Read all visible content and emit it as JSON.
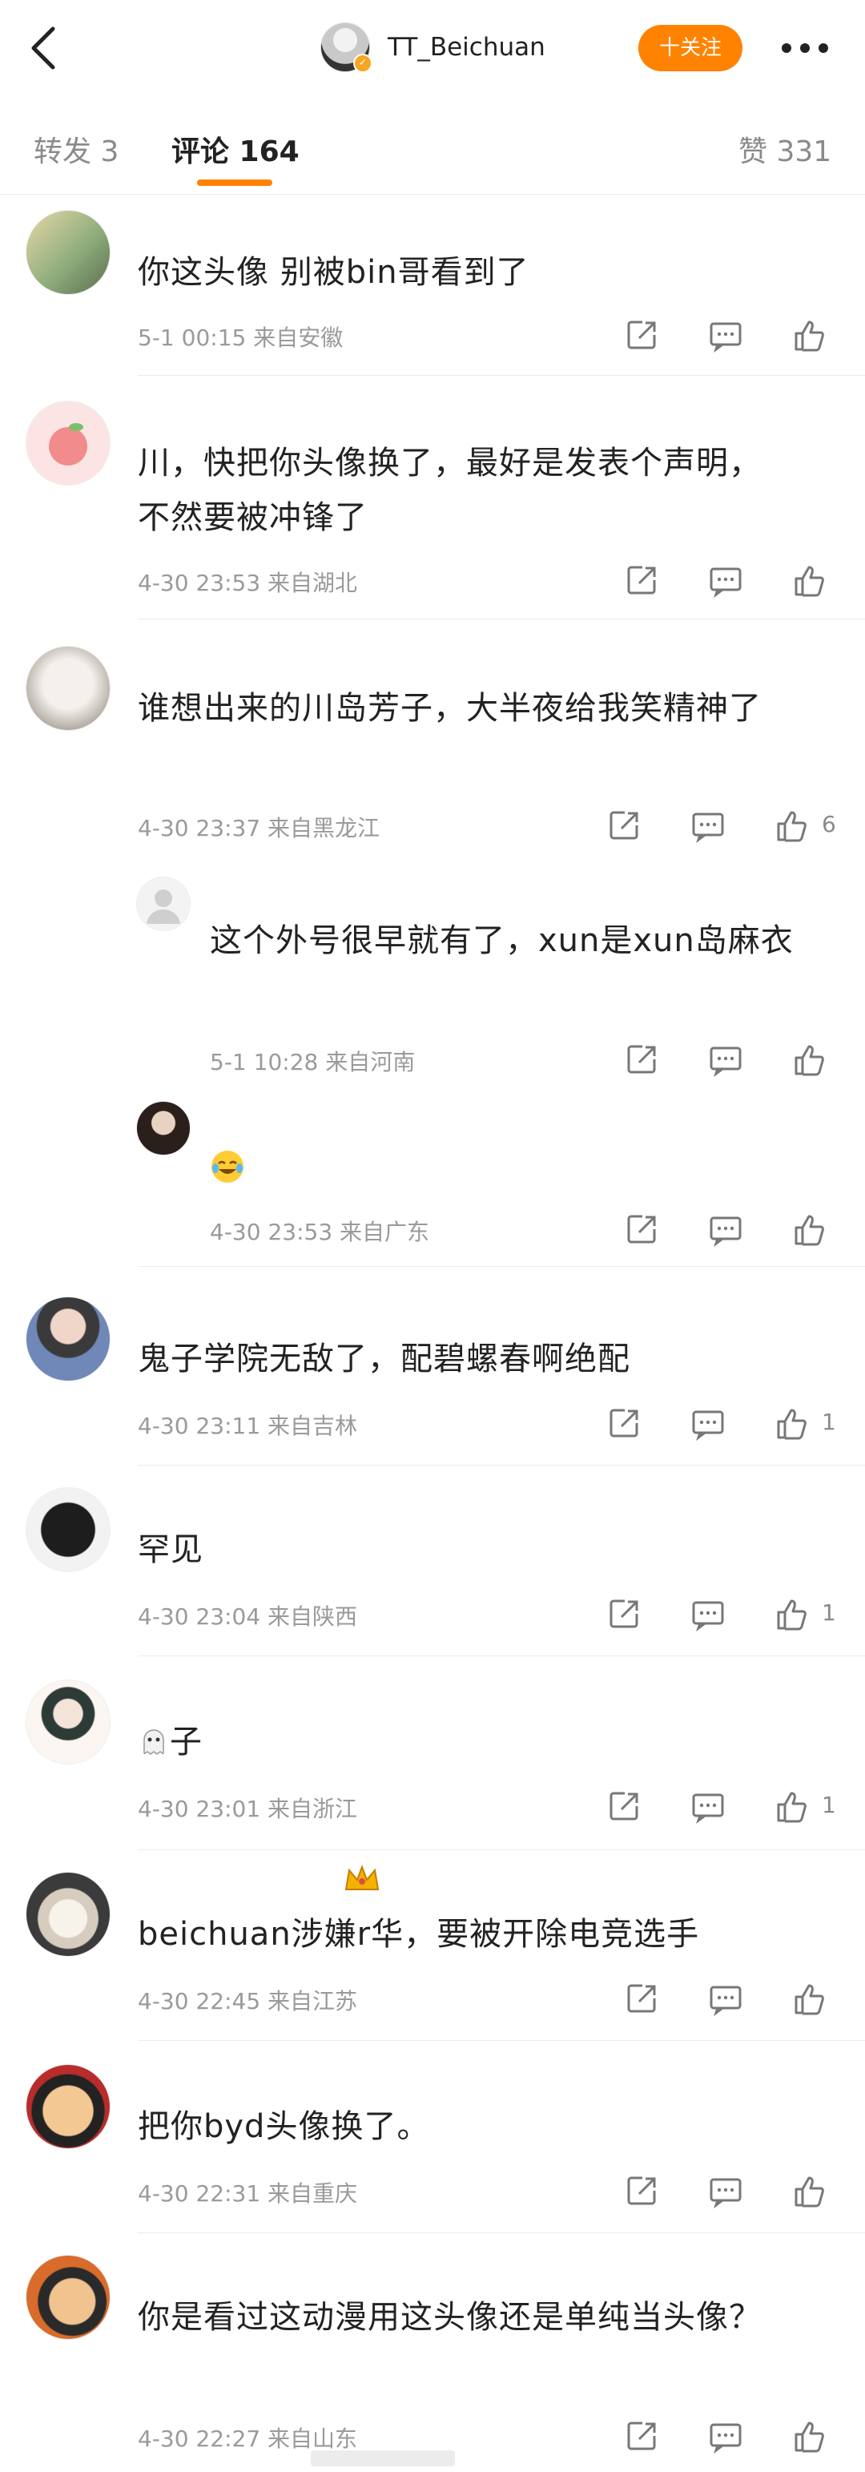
{
  "header": {
    "title": "TT_Beichuan",
    "follow_label": "十关注"
  },
  "tabs": [
    {
      "label": "转发 3"
    },
    {
      "label": "评论 164"
    },
    {
      "label": "赞 331"
    }
  ],
  "comments": [
    {
      "text": "你这头像 别被bin哥看到了",
      "time": "5-1 00:15",
      "location": "来自安徽",
      "likes": ""
    },
    {
      "text": "川，快把你头像换了，最好是发表个声明，不然要被冲锋了",
      "time": "4-30 23:53",
      "location": "来自湖北",
      "likes": ""
    },
    {
      "text": "谁想出来的川岛芳子，大半夜给我笑精神了",
      "time": "4-30 23:37",
      "location": "来自黑龙江",
      "likes": "6"
    },
    {
      "text": "这个外号很早就有了，xun是xun岛麻衣",
      "time": "5-1 10:28",
      "location": "来自河南",
      "likes": ""
    },
    {
      "text": "",
      "time": "4-30 23:53",
      "location": "来自广东",
      "likes": ""
    },
    {
      "text": "鬼子学院无敌了，配碧螺春啊绝配",
      "time": "4-30 23:11",
      "location": "来自吉林",
      "likes": "1"
    },
    {
      "text": "罕见",
      "time": "4-30 23:04",
      "location": "来自陕西",
      "likes": "1"
    },
    {
      "text": "子",
      "time": "4-30 23:01",
      "location": "来自浙江",
      "likes": "1"
    },
    {
      "text": "beichuan涉嫌r华，要被开除电竞选手",
      "time": "4-30 22:45",
      "location": "来自江苏",
      "likes": ""
    },
    {
      "text": "把你byd头像换了。",
      "time": "4-30 22:31",
      "location": "来自重庆",
      "likes": ""
    },
    {
      "text": "你是看过这动漫用这头像还是单纯当头像？",
      "time": "4-30 22:27",
      "location": "来自山东",
      "likes": ""
    }
  ],
  "icons": {
    "back": "chevron-left-icon",
    "more": "more-dots-icon",
    "share": "share-icon",
    "reply": "comment-icon",
    "like": "thumb-up-icon",
    "emoji": "laugh-cry-emoji-icon",
    "ghost": "ghost-emoji-icon",
    "crown": "crown-badge-icon"
  },
  "colors": {
    "accent": "#ff8200",
    "meta": "#9a9a9a"
  }
}
